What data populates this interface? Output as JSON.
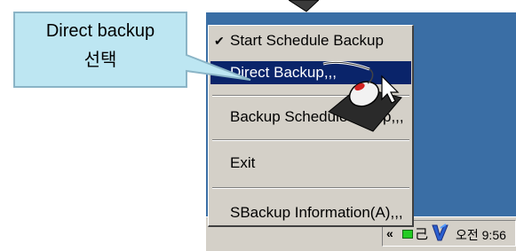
{
  "callout": {
    "line1": "Direct backup",
    "line2": "선택"
  },
  "menu": {
    "items": [
      {
        "label": "Start Schedule Backup",
        "checked": true,
        "highlighted": false
      },
      {
        "label": "Direct Backup,,,",
        "checked": false,
        "highlighted": true
      },
      {
        "label": "Backup Schedule Setup,,,",
        "checked": false,
        "highlighted": false
      },
      {
        "label": "Exit",
        "checked": false,
        "highlighted": false
      },
      {
        "label": "SBackup Information(A),,,",
        "checked": false,
        "highlighted": false
      }
    ],
    "check_glyph": "✔"
  },
  "tray": {
    "chevron": "«",
    "ime_label": "己",
    "clock": "오전 9:56",
    "icons": [
      "network-icon",
      "ime-icon",
      "sbackup-tray-icon"
    ]
  },
  "colors": {
    "desktop": "#3a6ea5",
    "menu_bg": "#d4d0c8",
    "highlight": "#0a246a",
    "callout_fill": "#bde6f2",
    "callout_border": "#8ab4c6"
  }
}
